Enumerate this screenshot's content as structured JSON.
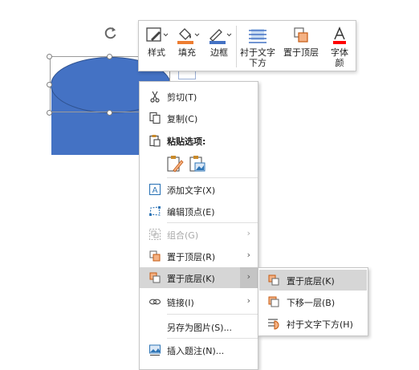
{
  "colors": {
    "shape_fill": "#4472c4",
    "fill_swatch": "#ed7d31",
    "border_swatch": "#4472c4",
    "font_color_bar": "#ff0000",
    "menu_hover": "#d6d6d6"
  },
  "mini_toolbar": {
    "style": "样式",
    "fill": "填充",
    "border": "边框",
    "behind_text_line1": "衬于文字",
    "behind_text_line2": "下方",
    "bring_front": "置于顶层",
    "font_color_line1": "字体",
    "font_color_line2": "颜"
  },
  "context_menu": {
    "cut": "剪切(T)",
    "copy": "复制(C)",
    "paste_options": "粘贴选项:",
    "add_text": "添加文字(X)",
    "edit_points": "编辑顶点(E)",
    "group": "组合(G)",
    "bring_to_front": "置于顶层(R)",
    "send_to_back": "置于底层(K)",
    "link": "链接(I)",
    "save_as_picture": "另存为图片(S)...",
    "insert_caption": "插入题注(N)..."
  },
  "submenu": {
    "send_to_back": "置于底层(K)",
    "send_backward": "下移一层(B)",
    "behind_text": "衬于文字下方(H)"
  },
  "icons": [
    "rotate-icon",
    "style-icon",
    "fill-icon",
    "border-icon",
    "behind-text-icon",
    "bring-front-icon",
    "font-color-icon",
    "scissors-icon",
    "copy-icon",
    "paste-icon",
    "paste-keep-format-icon",
    "paste-picture-icon",
    "add-text-icon",
    "edit-points-icon",
    "group-icon",
    "bring-front-icon",
    "send-back-icon",
    "link-icon",
    "caption-icon",
    "send-backward-icon",
    "chevron-right-icon"
  ]
}
